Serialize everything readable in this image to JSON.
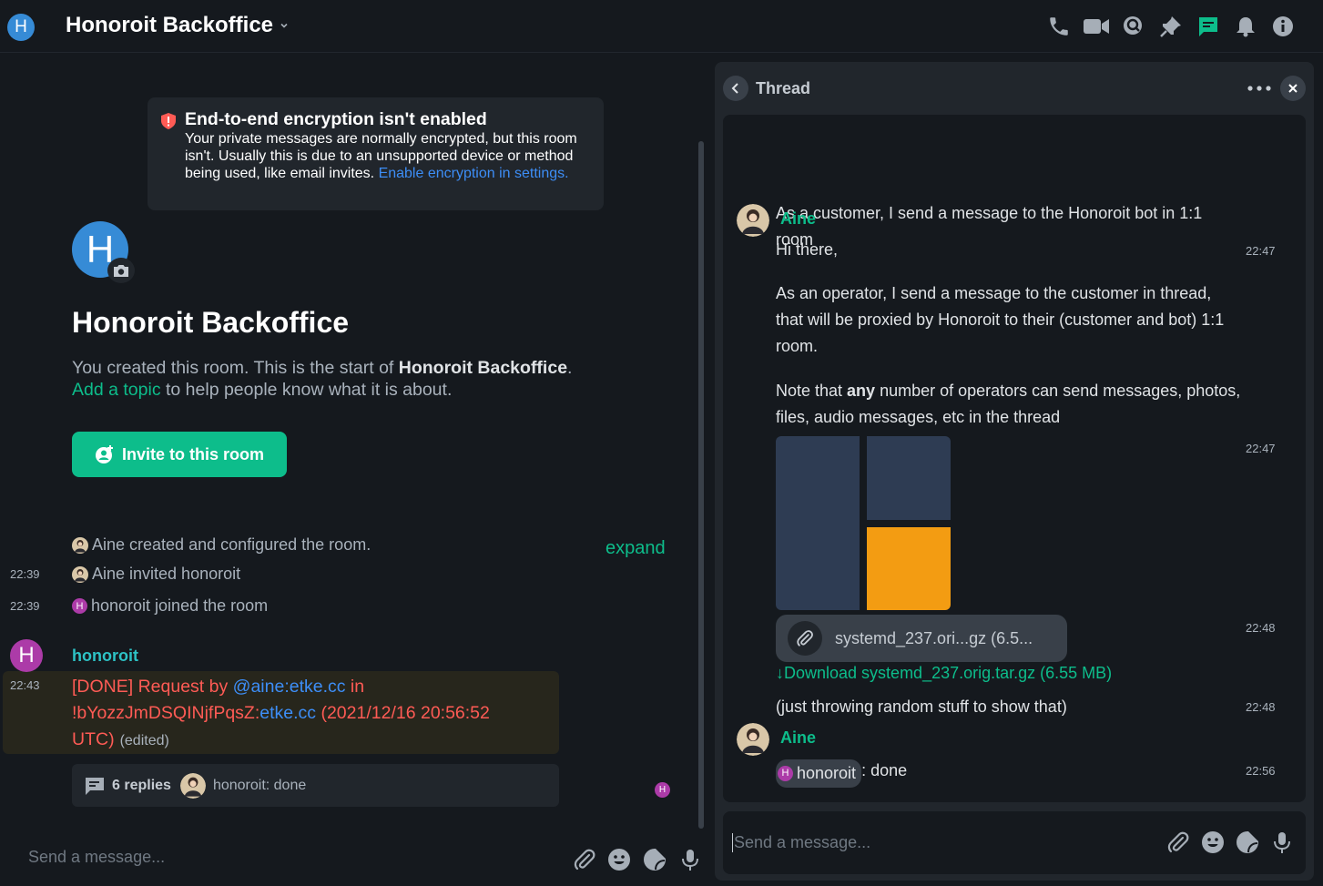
{
  "header": {
    "room_avatar_letter": "H",
    "room_name": "Honoroit Backoffice",
    "icons": [
      "phone-icon",
      "video-icon",
      "search-icon",
      "pin-icon",
      "threads-icon",
      "bell-icon",
      "info-icon"
    ],
    "active_icon_color": "#0dbd8b"
  },
  "encryption_notice": {
    "title": "End-to-end encryption isn't enabled",
    "body": "Your private messages are normally encrypted, but this room isn't. Usually this is due to an unsupported device or method being used, like email invites.",
    "link": "Enable encryption in settings."
  },
  "intro": {
    "avatar_letter": "H",
    "title": "Honoroit Backoffice",
    "created_prefix": "You created this room. This is the start of ",
    "room_name_bold": "Honoroit Backoffice",
    "created_suffix": ".",
    "add_topic": "Add a topic",
    "topic_suffix": " to help people know what it is about.",
    "invite_button": "Invite to this room"
  },
  "events": [
    {
      "time": "",
      "text": "Aine created and configured the room."
    },
    {
      "time": "22:39",
      "text": "Aine invited honoroit"
    },
    {
      "time": "22:39",
      "text": "honoroit joined the room",
      "avatar_letter": "H"
    }
  ],
  "expand_label": "expand",
  "message": {
    "avatar_letter": "H",
    "sender": "honoroit",
    "time": "22:43",
    "prefix": "[DONE] Request by ",
    "user_link": "@aine:etke.cc",
    "mid": " in ",
    "room_id": "!bYozzJmDSQINjfPqsZ:",
    "room_server": "etke.cc",
    "suffix": " (2021/12/16 20:56:52 UTC)",
    "edited": "(edited)",
    "highlight_color": "#27261c"
  },
  "thread_summary": {
    "replies": "6 replies",
    "last_message": "honoroit: done",
    "read_receipt_letter": "H"
  },
  "composer": {
    "placeholder": "Send a message..."
  },
  "thread": {
    "title": "Thread",
    "sender": "Aine",
    "first_message": "As a customer, I send a message to the Honoroit bot in 1:1 room",
    "hi": "Hi there,",
    "hi_time": "22:47",
    "operator_text": "As an operator, I send a message to the customer in thread, that will be proxied by Honoroit to their (customer and bot) 1:1 room.",
    "note_prefix": "Note that ",
    "note_bold": "any",
    "note_suffix": " number of operators can send messages, photos, files, audio messages, etc in the thread",
    "image_time": "22:47",
    "file_name": "systemd_237.ori...gz (6.5...",
    "file_time": "22:48",
    "download": "↓Download systemd_237.orig.tar.gz (6.55 MB)",
    "random_text": "(just throwing random stuff to show that)",
    "random_time": "22:48",
    "second_sender": "Aine",
    "mention": "honoroit",
    "mention_letter": "H",
    "done_text": ": done",
    "done_time": "22:56",
    "composer_placeholder": "Send a message...",
    "image_colors": [
      "#2e3c53",
      "#f39c12"
    ]
  }
}
